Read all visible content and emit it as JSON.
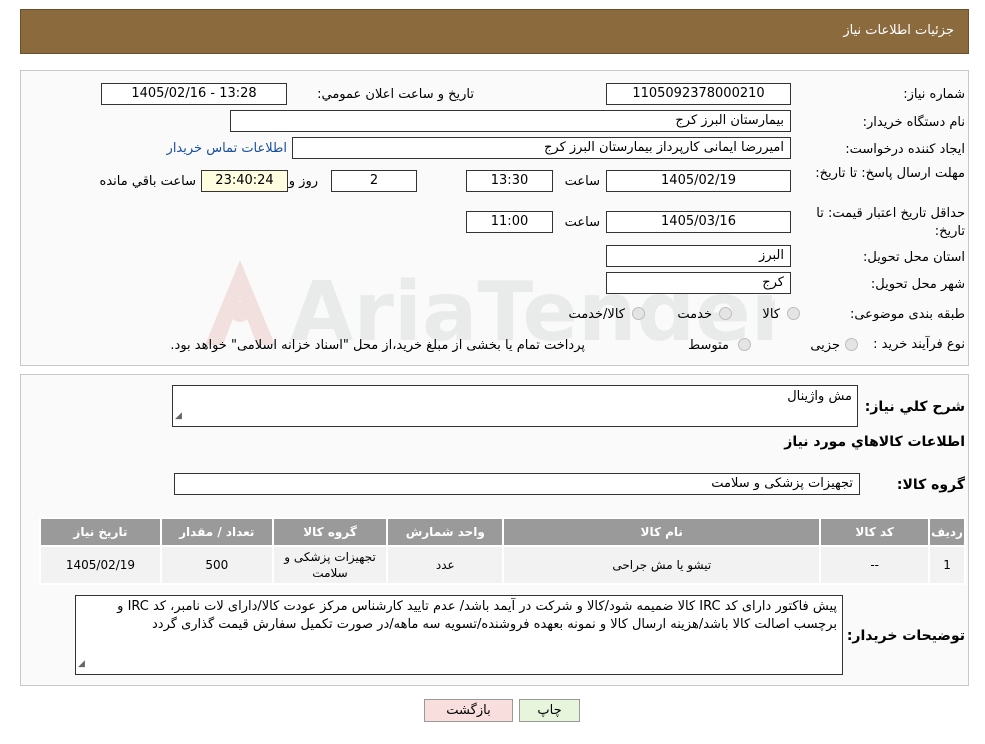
{
  "header": {
    "title": "جزئیات اطلاعات نیاز"
  },
  "form": {
    "need_number_label": "شماره نیاز:",
    "need_number": "1105092378000210",
    "announce_label": "تاریخ و ساعت اعلان عمومي:",
    "announce_value": "1405/02/16 - 13:28",
    "buyer_org_label": "نام دستگاه خریدار:",
    "buyer_org": "بیمارستان البرز کرج",
    "creator_label": "ایجاد کننده درخواست:",
    "creator": "امیررضا ایمانی کارپرداز بیمارستان البرز کرج",
    "contact_link": "اطلاعات تماس خریدار",
    "deadline_label": "مهلت ارسال پاسخ: تا تاریخ:",
    "deadline_date": "1405/02/19",
    "time_label": "ساعت",
    "deadline_time": "13:30",
    "days_value": "2",
    "days_label": "روز و",
    "remaining_time": "23:40:24",
    "remaining_label": "ساعت باقي مانده",
    "validity_label": "حداقل تاریخ اعتبار قیمت: تا تاریخ:",
    "validity_date": "1405/03/16",
    "validity_time": "11:00",
    "province_label": "استان محل تحویل:",
    "province": "البرز",
    "city_label": "شهر محل تحویل:",
    "city": "کرج",
    "category_label": "طبقه بندی موضوعی:",
    "category_options": [
      "کالا",
      "خدمت",
      "کالا/خدمت"
    ],
    "process_label": "نوع فرآیند خرید :",
    "process_options": [
      "جزیی",
      "متوسط"
    ],
    "process_note": "پرداخت تمام یا بخشی از مبلغ خرید،از محل \"اسناد خزانه اسلامی\" خواهد بود."
  },
  "details": {
    "summary_label": "شرح کلي نياز:",
    "summary": "مش واژینال",
    "goods_info_title": "اطلاعات کالاهاي مورد نياز",
    "goods_group_label": "گروه کالا:",
    "goods_group": "تجهیزات پزشکی و سلامت",
    "table_headers": [
      "رديف",
      "کد کالا",
      "نام کالا",
      "واحد شمارش",
      "گروه کالا",
      "تعداد / مقدار",
      "تاریخ نیاز"
    ],
    "rows": [
      [
        "1",
        "--",
        "تیشو یا مش جراحی",
        "عدد",
        "تجهیزات پزشکی و سلامت",
        "500",
        "1405/02/19"
      ]
    ],
    "buyer_notes_label": "توضیحات خریدار:",
    "buyer_notes": "پیش فاکتور دارای کد IRC کالا ضمیمه شود/کالا و شرکت در آیمد باشد/ عدم تایید کارشناس مرکز عودت کالا/دارای لات نامبر، کد IRC و برچسب اصالت کالا باشد/هزینه ارسال کالا و نمونه بعهده فروشنده/تسویه سه ماهه/در صورت تکمیل سفارش قیمت گذاری گردد"
  },
  "buttons": {
    "print": "چاپ",
    "back": "بازگشت"
  },
  "colors": {
    "header_bg": "#8b6a3e",
    "print_btn": "#e6f5dc",
    "back_btn": "#f9dede"
  }
}
